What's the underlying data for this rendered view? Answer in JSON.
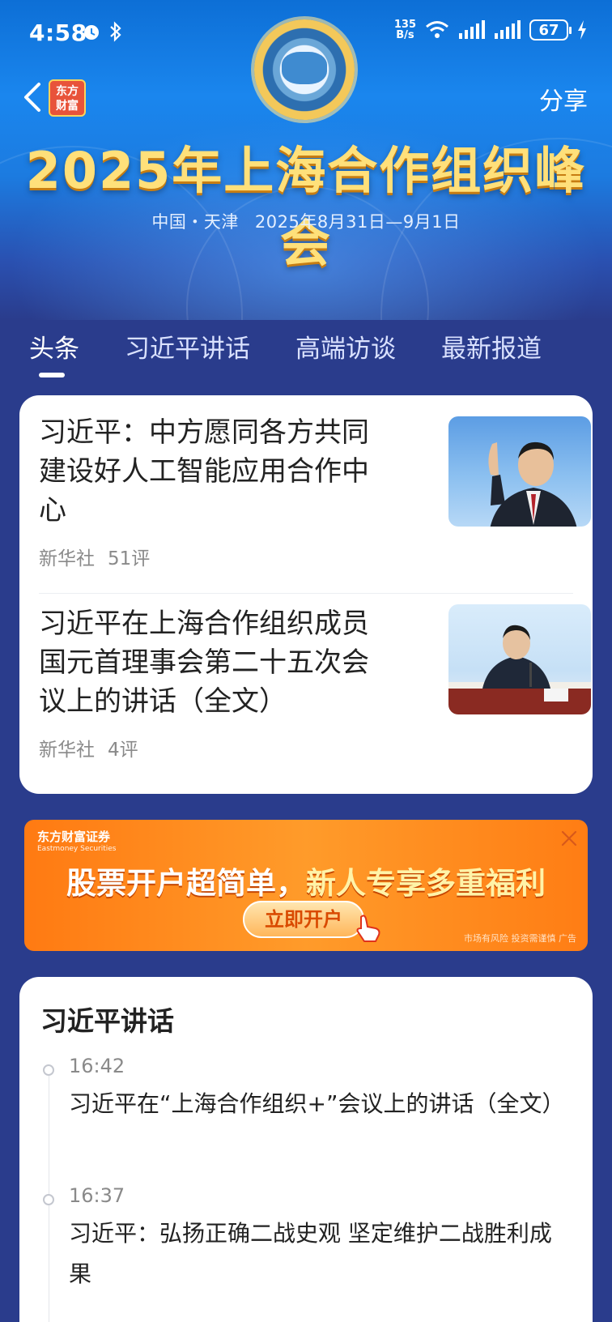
{
  "status_bar": {
    "time": "4:58",
    "speed_value": "135",
    "speed_unit": "B/s",
    "battery": "67"
  },
  "header": {
    "back_icon": "chevron-left-icon",
    "logo_line1": "东方",
    "logo_line2": "财富",
    "share_label": "分享",
    "title": "2025年上海合作组织峰会",
    "location": "中国・天津",
    "dates": "2025年8月31日—9月1日"
  },
  "tabs": [
    {
      "label": "头条",
      "active": true
    },
    {
      "label": "习近平讲话",
      "active": false
    },
    {
      "label": "高端访谈",
      "active": false
    },
    {
      "label": "最新报道",
      "active": false
    }
  ],
  "news": [
    {
      "title": "习近平：中方愿同各方共同建设好人工智能应用合作中心",
      "source": "新华社",
      "comments": "51评"
    },
    {
      "title": "习近平在上海合作组织成员国元首理事会第二十五次会议上的讲话（全文）",
      "source": "新华社",
      "comments": "4评"
    }
  ],
  "ad": {
    "brand": "东方财富证券",
    "brand_en": "Eastmoney Securities",
    "headline_part1": "股票开户超简单，",
    "headline_part2": "新人专享多重福利",
    "cta": "立即开户",
    "note": "市场有风险 投资需谨慎 广告"
  },
  "speech_section": {
    "title": "习近平讲话",
    "items": [
      {
        "time": "16:42",
        "text": "习近平在“上海合作组织+”会议上的讲话（全文）"
      },
      {
        "time": "16:37",
        "text": "习近平：弘扬正确二战史观 坚定维护二战胜利成果"
      }
    ]
  },
  "colors": {
    "page_bg": "#2a3c8c",
    "title_gold": "#ffe07a",
    "ad_orange": "#ff8a1e"
  }
}
